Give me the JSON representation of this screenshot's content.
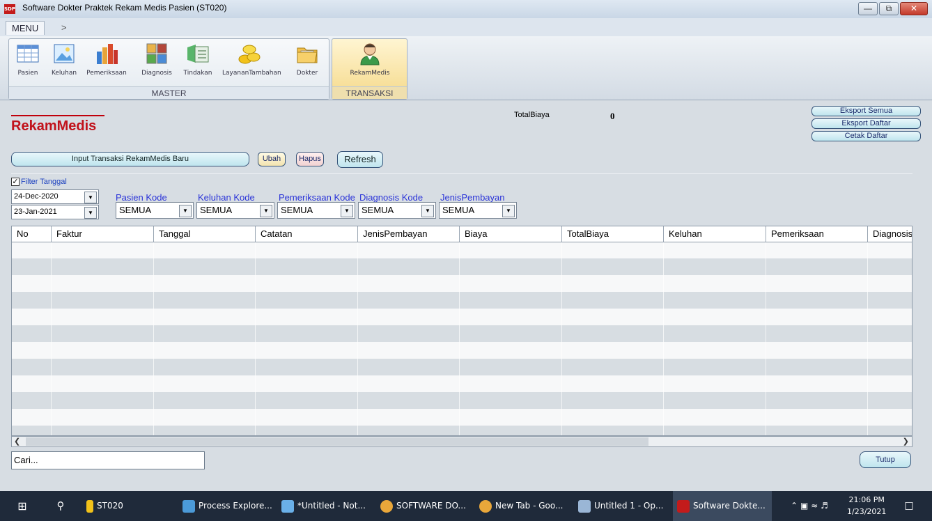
{
  "window": {
    "title": "Software Dokter Praktek Rekam Medis Pasien (ST020)",
    "icon_text": "SDP"
  },
  "menu": {
    "tab": "MENU",
    "arrow": ">"
  },
  "ribbon": {
    "master_label": "MASTER",
    "transaksi_label": "TRANSAKSI",
    "master_items": [
      "Pasien",
      "Keluhan",
      "Pemeriksaan",
      "Diagnosis",
      "Tindakan",
      "LayananTambahan",
      "Dokter"
    ],
    "transaksi_items": [
      "RekamMedis"
    ]
  },
  "page": {
    "title": "RekamMedis",
    "totalbiaya_label": "TotalBiaya",
    "totalbiaya_value": "0"
  },
  "buttons": {
    "eksport_semua": "Eksport Semua",
    "eksport_daftar": "Eksport Daftar",
    "cetak_daftar": "Cetak Daftar",
    "input_baru": "Input Transaksi RekamMedis Baru",
    "ubah": "Ubah",
    "hapus": "Hapus",
    "refresh": "Refresh",
    "tutup": "Tutup"
  },
  "filters": {
    "filter_tanggal_label": "Filter Tanggal",
    "filter_tanggal_checked": true,
    "date_from": "24-Dec-2020",
    "date_to": "23-Jan-2021",
    "pasien_kode_label": "Pasien Kode",
    "pasien_kode_value": "SEMUA",
    "keluhan_kode_label": "Keluhan Kode",
    "keluhan_kode_value": "SEMUA",
    "pemeriksaan_kode_label": "Pemeriksaan Kode",
    "pemeriksaan_kode_value": "SEMUA",
    "diagnosis_kode_label": "Diagnosis Kode",
    "diagnosis_kode_value": "SEMUA",
    "jenis_pembayaran_label": "JenisPembayan",
    "jenis_pembayaran_value": "SEMUA"
  },
  "grid": {
    "columns": [
      "No",
      "Faktur",
      "Tanggal",
      "Catatan",
      "JenisPembayan",
      "Biaya",
      "TotalBiaya",
      "Keluhan",
      "Pemeriksaan",
      "Diagnosis"
    ]
  },
  "search": {
    "placeholder": "Cari..."
  },
  "taskbar": {
    "items": [
      "ST020",
      "Process Explore...",
      "*Untitled - Not...",
      "SOFTWARE DO...",
      "New Tab - Goo...",
      "Untitled 1 - Op...",
      "Software Dokte..."
    ],
    "time": "21:06 PM",
    "date": "1/23/2021"
  },
  "colors": {
    "title_red": "#c1121b",
    "filter_label_blue": "#2a33d8",
    "taskbar_bg": "#1f2a3a"
  }
}
